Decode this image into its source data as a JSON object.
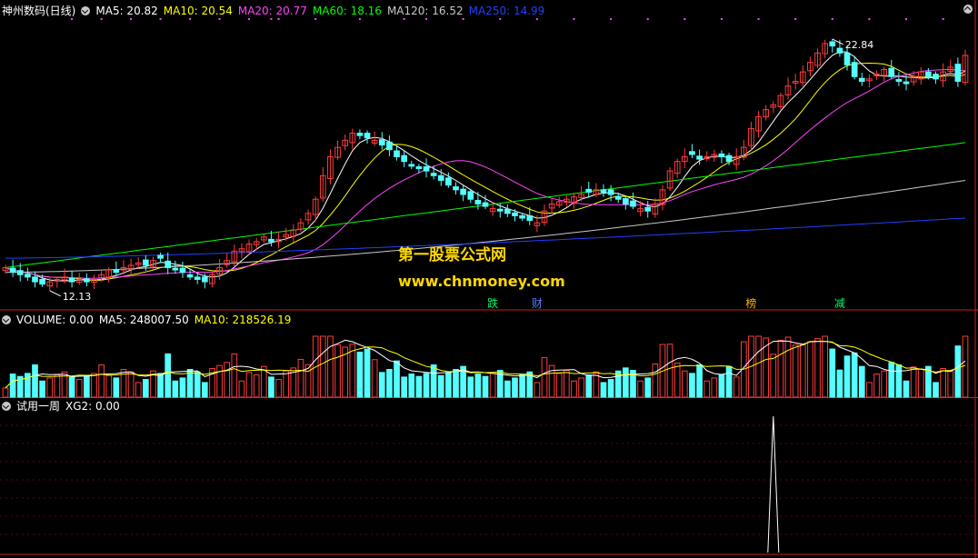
{
  "colors": {
    "bg": "#000000",
    "up": "#ff3c3c",
    "down": "#54ffff",
    "ma5": "#ffffff",
    "ma10": "#ffff00",
    "ma20": "#ff44ff",
    "ma60": "#00ff00",
    "ma120": "#c8c8c8",
    "ma250": "#2040ff",
    "divider": "#c81e1e",
    "grid": "#6a0000",
    "signal_dot": "#ff44ff"
  },
  "main_panel": {
    "stock_name": "神州数码(日线)",
    "ma_labels": [
      {
        "text": "MA5: 20.82",
        "color": "#ffffff"
      },
      {
        "text": "MA10: 20.54",
        "color": "#ffff00"
      },
      {
        "text": "MA20: 20.77",
        "color": "#ff44ff"
      },
      {
        "text": "MA60: 18.16",
        "color": "#00ff00"
      },
      {
        "text": "MA120: 16.52",
        "color": "#c8c8c8"
      },
      {
        "text": "MA250: 14.99",
        "color": "#2040ff"
      }
    ],
    "high_marker": "22.84",
    "low_marker": "12.13",
    "event_markers": [
      {
        "text": "跌",
        "color": "#00ff66",
        "index": 66
      },
      {
        "text": "财",
        "color": "#5a7bff",
        "index": 72
      },
      {
        "text": "榜",
        "color": "#ffb000",
        "index": 101
      },
      {
        "text": "减",
        "color": "#00ff66",
        "index": 113
      }
    ]
  },
  "volume_panel": {
    "title": "VOLUME: 0.00",
    "ma5": "MA5: 248007.50",
    "ma10": "MA10: 218526.19"
  },
  "xg2_panel": {
    "title": "试用一周",
    "value": "XG2: 0.00"
  },
  "watermark": {
    "line1": "第一股票公式网",
    "line2": "www.chnmoney.com"
  },
  "chart_data": {
    "type": "candlestick",
    "price_range": [
      11.3,
      23.4
    ],
    "closes": [
      12.9,
      12.7,
      12.6,
      12.5,
      12.3,
      12.2,
      12.3,
      12.4,
      12.5,
      12.3,
      12.4,
      12.3,
      12.4,
      12.6,
      12.8,
      12.7,
      12.9,
      13.0,
      13.1,
      13.0,
      13.2,
      13.3,
      12.9,
      12.8,
      12.7,
      12.5,
      12.4,
      12.3,
      12.6,
      12.9,
      13.2,
      13.6,
      13.7,
      13.9,
      14.0,
      14.2,
      14.0,
      14.1,
      14.3,
      14.5,
      14.8,
      15.2,
      15.8,
      16.8,
      17.6,
      18.0,
      18.3,
      18.6,
      18.5,
      18.4,
      18.3,
      18.1,
      17.9,
      17.6,
      17.4,
      17.2,
      17.1,
      17.0,
      16.8,
      16.6,
      16.4,
      16.2,
      16.0,
      15.8,
      15.6,
      15.5,
      15.4,
      15.3,
      15.2,
      15.1,
      15.0,
      14.9,
      14.8,
      15.3,
      15.6,
      15.7,
      15.8,
      15.9,
      16.0,
      16.1,
      16.2,
      16.1,
      16.0,
      15.8,
      15.6,
      15.5,
      15.4,
      15.3,
      15.6,
      16.2,
      17.0,
      17.4,
      17.6,
      17.7,
      17.5,
      17.6,
      17.7,
      17.6,
      17.4,
      17.6,
      18.0,
      18.8,
      19.3,
      19.6,
      19.8,
      20.2,
      20.6,
      20.8,
      21.2,
      21.6,
      22.0,
      22.4,
      22.3,
      22.0,
      21.5,
      21.0,
      20.8,
      20.9,
      21.1,
      21.3,
      21.0,
      20.8,
      20.7,
      21.0,
      21.2,
      21.0,
      20.9,
      21.2,
      21.4,
      20.8,
      21.9
    ],
    "volume_max": 1000,
    "xg2_signal_index": 104
  }
}
